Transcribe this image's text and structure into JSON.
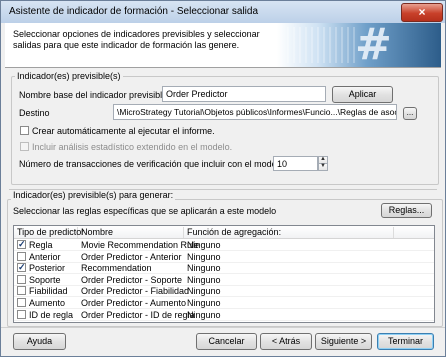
{
  "window": {
    "title": "Asistente de indicador de formación - Seleccionar salida",
    "close_icon": "×"
  },
  "header": {
    "description": "Seleccionar opciones de indicadores previsibles y seleccionar salidas para que este indicador de formación las genere.",
    "art_icon": "hash-graphic"
  },
  "indicators_group": {
    "label": "Indicador(es) previsible(s)",
    "base_name_label": "Nombre base del indicador previsible:",
    "base_name_value": "Order Predictor",
    "apply_button": "Aplicar",
    "destination_label": "Destino",
    "destination_value": "\\MicroStrategy Tutorial\\Objetos públicos\\Informes\\Funcio...\\Reglas de asociación",
    "browse_button": "...",
    "auto_create_label": "Crear automáticamente al ejecutar el informe.",
    "auto_create_checked": false,
    "extended_stats_label": "Incluir análisis estadístico extendido en el modelo.",
    "extended_stats_checked": false,
    "verification_label": "Número de transacciones de verificación que incluir con el modelo:",
    "verification_value": "10"
  },
  "generate_group": {
    "label": "Indicador(es) previsible(s) para generar:",
    "rules_label": "Seleccionar las reglas específicas que se aplicarán a este modelo",
    "rules_button": "Reglas...",
    "columns": [
      "Tipo de predictor",
      "Nombre",
      "Función de agregación:"
    ],
    "rows": [
      {
        "checked": true,
        "type": "Regla",
        "name": "Movie Recommendation Rule",
        "agg": "Ninguno"
      },
      {
        "checked": false,
        "type": "Anterior",
        "name": "Order Predictor - Anterior",
        "agg": "Ninguno"
      },
      {
        "checked": true,
        "type": "Posterior",
        "name": "Recommendation",
        "agg": "Ninguno"
      },
      {
        "checked": false,
        "type": "Soporte",
        "name": "Order Predictor - Soporte",
        "agg": "Ninguno"
      },
      {
        "checked": false,
        "type": "Fiabilidad",
        "name": "Order Predictor - Fiabilidad",
        "agg": "Ninguno"
      },
      {
        "checked": false,
        "type": "Aumento",
        "name": "Order Predictor - Aumento",
        "agg": "Ninguno"
      },
      {
        "checked": false,
        "type": "ID de regla",
        "name": "Order Predictor - ID de regla",
        "agg": "Ninguno"
      }
    ]
  },
  "footer": {
    "help": "Ayuda",
    "cancel": "Cancelar",
    "back": "< Atrás",
    "next": "Siguiente >",
    "finish": "Terminar"
  }
}
